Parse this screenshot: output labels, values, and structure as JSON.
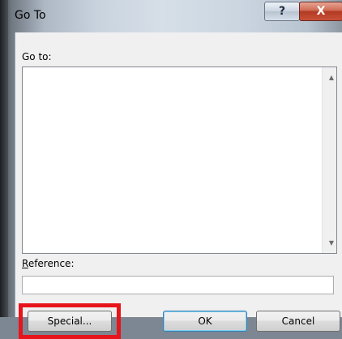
{
  "window": {
    "title": "Go To",
    "help_label": "?",
    "close_label": "X"
  },
  "goto": {
    "label": "Go to:",
    "items": []
  },
  "reference": {
    "label": "Reference:",
    "value": ""
  },
  "buttons": {
    "special_label": "Special...",
    "ok_label": "OK",
    "cancel_label": "Cancel"
  },
  "scroll": {
    "up_icon": "▲",
    "down_icon": "▼"
  },
  "colors": {
    "highlight": "#e8141b",
    "close_button": "#c95038"
  }
}
